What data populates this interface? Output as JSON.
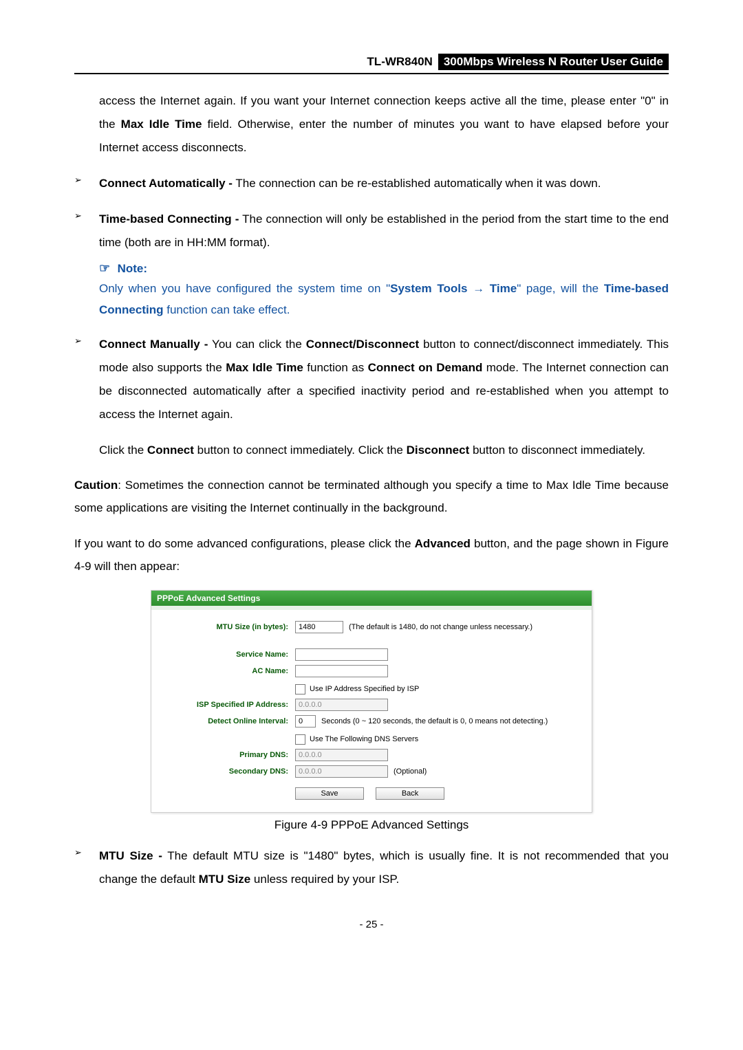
{
  "header": {
    "model": "TL-WR840N",
    "title": "300Mbps Wireless N Router User Guide"
  },
  "intro_cont": {
    "pre": "access the Internet again. If you want your Internet connection keeps active all the time, please enter \"0\" in the ",
    "bold1": "Max Idle Time",
    "post": " field. Otherwise, enter the number of minutes you want to have elapsed before your Internet access disconnects."
  },
  "bullets": {
    "b1": {
      "label": "Connect Automatically -",
      "text": " The connection can be re-established automatically when it was down."
    },
    "b2": {
      "label": "Time-based Connecting -",
      "text": " The connection will only be established in the period from the start time to the end time (both are in HH:MM format)."
    },
    "b3": {
      "label": "Connect Manually -",
      "t1": " You can click the ",
      "bold_cd": "Connect/Disconnect",
      "t2": " button to connect/disconnect immediately. This mode also supports the ",
      "bold_mit": "Max Idle Time",
      "t3": " function as ",
      "bold_cod": "Connect on Demand",
      "t4": " mode. The Internet connection can be disconnected automatically after a specified inactivity period and re-established when you attempt to access the Internet again."
    },
    "b4": {
      "label": "MTU Size -",
      "t1": " The default MTU size is \"1480\" bytes, which is usually fine. It is not recommended that you change the default ",
      "bold": "MTU Size",
      "t2": " unless required by your ISP."
    }
  },
  "note": {
    "head": "Note:",
    "t1": "Only when you have configured the system time on \"",
    "bold1": "System Tools → Time",
    "t2": "\" page, will the ",
    "bold2": "Time-based Connecting",
    "t3": " function can take effect."
  },
  "click_para": {
    "t1": "Click the ",
    "bold1": "Connect",
    "t2": " button to connect immediately. Click the ",
    "bold2": "Disconnect",
    "t3": " button to disconnect immediately."
  },
  "caution": {
    "label": "Caution",
    "text": ": Sometimes the connection cannot be terminated although you specify a time to Max Idle Time because some applications are visiting the Internet continually in the background."
  },
  "adv_para": {
    "t1": "If you want to do some advanced configurations, please click the ",
    "bold": "Advanced",
    "t2": " button, and the page shown in Figure 4-9 will then appear:"
  },
  "panel": {
    "title": "PPPoE Advanced Settings",
    "mtu_label": "MTU Size (in bytes):",
    "mtu_value": "1480",
    "mtu_hint": "(The default is 1480, do not change unless necessary.)",
    "service_label": "Service Name:",
    "ac_label": "AC Name:",
    "chk_ip": "Use IP Address Specified by ISP",
    "isp_ip_label": "ISP Specified IP Address:",
    "isp_ip_value": "0.0.0.0",
    "detect_label": "Detect Online Interval:",
    "detect_value": "0",
    "detect_hint": "Seconds (0 ~ 120 seconds, the default is 0, 0 means not detecting.)",
    "chk_dns": "Use The Following DNS Servers",
    "pdns_label": "Primary DNS:",
    "pdns_value": "0.0.0.0",
    "sdns_label": "Secondary DNS:",
    "sdns_value": "0.0.0.0",
    "optional": "(Optional)",
    "btn_save": "Save",
    "btn_back": "Back"
  },
  "fig_caption": "Figure 4-9 PPPoE Advanced Settings",
  "page_number": "- 25 -"
}
